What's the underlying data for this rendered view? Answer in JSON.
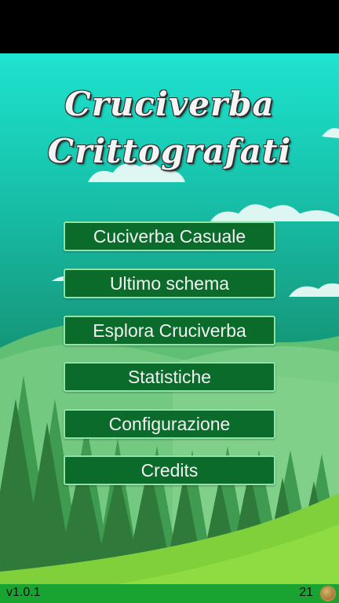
{
  "app": {
    "title_line1": "Cruciverba",
    "title_line2": "Crittografati"
  },
  "menu": {
    "items": [
      {
        "label": "Cuciverba Casuale"
      },
      {
        "label": "Ultimo schema"
      },
      {
        "label": "Esplora Cruciverba"
      },
      {
        "label": "Statistiche"
      },
      {
        "label": "Configurazione"
      },
      {
        "label": "Credits"
      }
    ]
  },
  "footer": {
    "version": "v1.0.1",
    "coins": "21",
    "coin_icon": "coin-icon"
  },
  "colors": {
    "button_bg": "#0b6b2b",
    "button_border": "#8fe4a8",
    "footer_bg": "#19a330"
  }
}
